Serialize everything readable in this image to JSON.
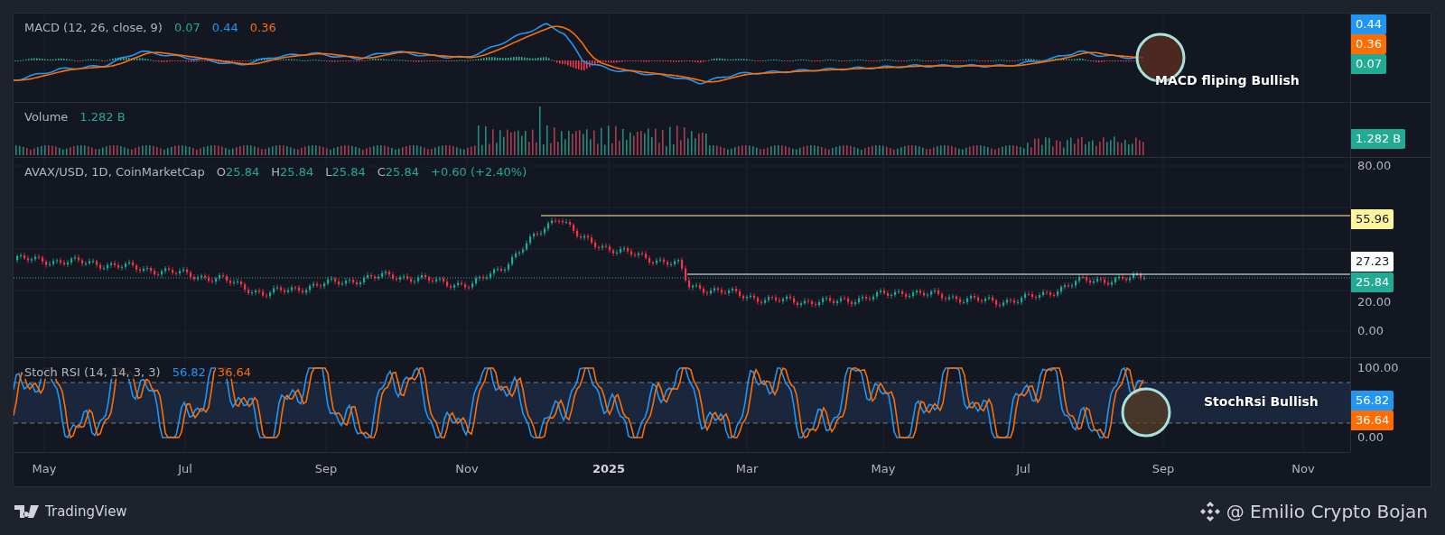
{
  "macd": {
    "legend": {
      "name": "MACD (12, 26, close, 9)",
      "values": [
        {
          "text": "0.07",
          "color": "#22ab94"
        },
        {
          "text": "0.44",
          "color": "#2196f3"
        },
        {
          "text": "0.36",
          "color": "#ff6d00"
        }
      ]
    },
    "annotation": "MACD fliping Bullish",
    "scale": [
      {
        "kind": "badge",
        "text": "0.44",
        "color": "#2196f3"
      },
      {
        "kind": "badge",
        "text": "0.36",
        "color": "#ff6d00"
      },
      {
        "kind": "badge",
        "text": "0.07",
        "color": "#22ab94"
      }
    ]
  },
  "volume": {
    "legend": {
      "name": "Volume",
      "values": [
        {
          "text": "1.282 B",
          "color": "#22ab94"
        }
      ]
    },
    "scale": [
      {
        "kind": "badge",
        "text": "1.282 B",
        "color": "#22ab94"
      }
    ]
  },
  "price": {
    "legend": {
      "name": "AVAX/USD, 1D, CoinMarketCap",
      "ohlc": [
        {
          "label": "O",
          "value": "25.84"
        },
        {
          "label": "H",
          "value": "25.84"
        },
        {
          "label": "L",
          "value": "25.84"
        },
        {
          "label": "C",
          "value": "25.84"
        }
      ],
      "change": "+0.60 (+2.40%)"
    },
    "scale": [
      {
        "kind": "tick",
        "text": "80.00"
      },
      {
        "kind": "badge",
        "text": "55.96",
        "color": "#fff59d"
      },
      {
        "kind": "badge",
        "text": "27.23",
        "color": "#ffffff"
      },
      {
        "kind": "badge",
        "text": "25.84",
        "color": "#22ab94"
      },
      {
        "kind": "tick",
        "text": "20.00"
      },
      {
        "kind": "tick",
        "text": "0.00"
      }
    ]
  },
  "stoch": {
    "legend": {
      "name": "Stoch RSI (14, 14, 3, 3)",
      "values": [
        {
          "text": "56.82",
          "color": "#2196f3"
        },
        {
          "text": "36.64",
          "color": "#ff6d00"
        }
      ]
    },
    "annotation": "StochRsi Bullish",
    "scale": [
      {
        "kind": "tick",
        "text": "100.00"
      },
      {
        "kind": "badge",
        "text": "56.82",
        "color": "#2196f3"
      },
      {
        "kind": "badge",
        "text": "36.64",
        "color": "#ff6d00"
      },
      {
        "kind": "tick",
        "text": "0.00"
      }
    ]
  },
  "time_axis": [
    {
      "text": "May",
      "kind": "month"
    },
    {
      "text": "Jul",
      "kind": "month"
    },
    {
      "text": "Sep",
      "kind": "month"
    },
    {
      "text": "Nov",
      "kind": "month"
    },
    {
      "text": "2025",
      "kind": "year"
    },
    {
      "text": "Mar",
      "kind": "month"
    },
    {
      "text": "May",
      "kind": "month"
    },
    {
      "text": "Jul",
      "kind": "month"
    },
    {
      "text": "Sep",
      "kind": "month"
    },
    {
      "text": "Nov",
      "kind": "month"
    }
  ],
  "footer": {
    "logo": "TradingView",
    "credit": "@ Emilio Crypto Bojan"
  }
}
